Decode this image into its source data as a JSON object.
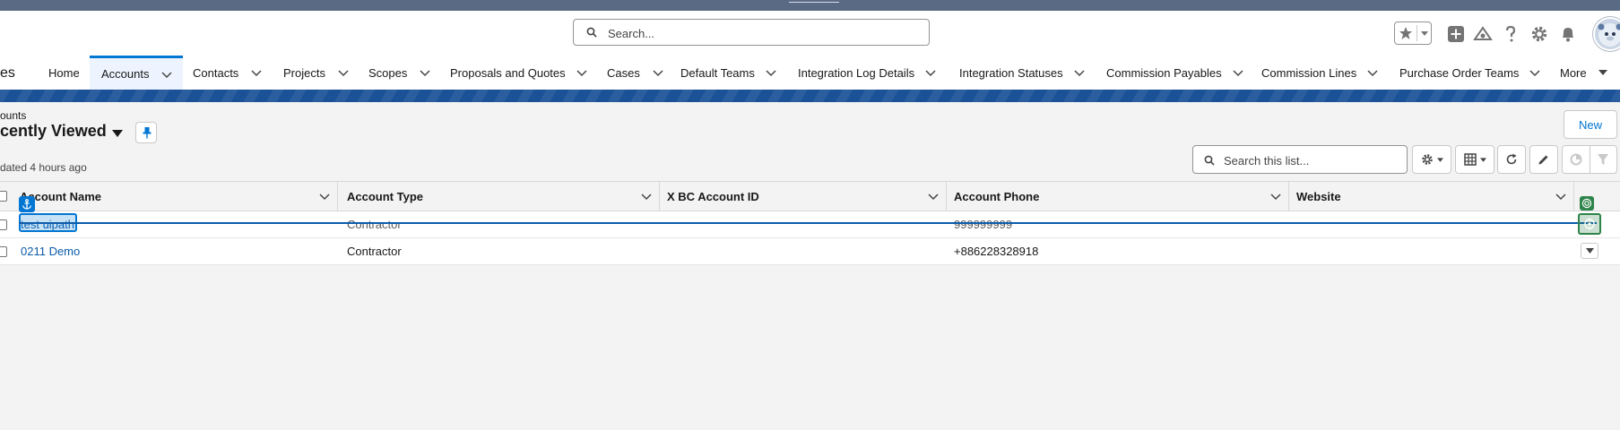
{
  "header": {
    "search_placeholder": "Search..."
  },
  "nav": {
    "app_name_fragment": "es",
    "items": [
      {
        "label": "Home"
      },
      {
        "label": "Accounts"
      },
      {
        "label": "Contacts"
      },
      {
        "label": "Projects"
      },
      {
        "label": "Scopes"
      },
      {
        "label": "Proposals and Quotes"
      },
      {
        "label": "Cases"
      },
      {
        "label": "Default Teams"
      },
      {
        "label": "Integration Log Details"
      },
      {
        "label": "Integration Statuses"
      },
      {
        "label": "Commission Payables"
      },
      {
        "label": "Commission Lines"
      },
      {
        "label": "Purchase Order Teams"
      },
      {
        "label": "More"
      }
    ]
  },
  "list": {
    "object_label": "ounts",
    "title": "cently Viewed",
    "updated": "dated 4 hours ago",
    "new_label": "New",
    "search_placeholder": "Search this list..."
  },
  "table": {
    "columns": [
      "Account Name",
      "Account Type",
      "X BC Account ID",
      "Account Phone",
      "Website"
    ],
    "rows": [
      [
        "test uipath",
        "Contractor",
        "",
        "999999999",
        ""
      ],
      [
        "0211 Demo",
        "Contractor",
        "",
        "+886228328918",
        ""
      ]
    ]
  },
  "colors": {
    "brand": "#0176d3",
    "nav_band": "#1b5297",
    "link": "#0b5cab",
    "target_green": "#2e844a"
  }
}
